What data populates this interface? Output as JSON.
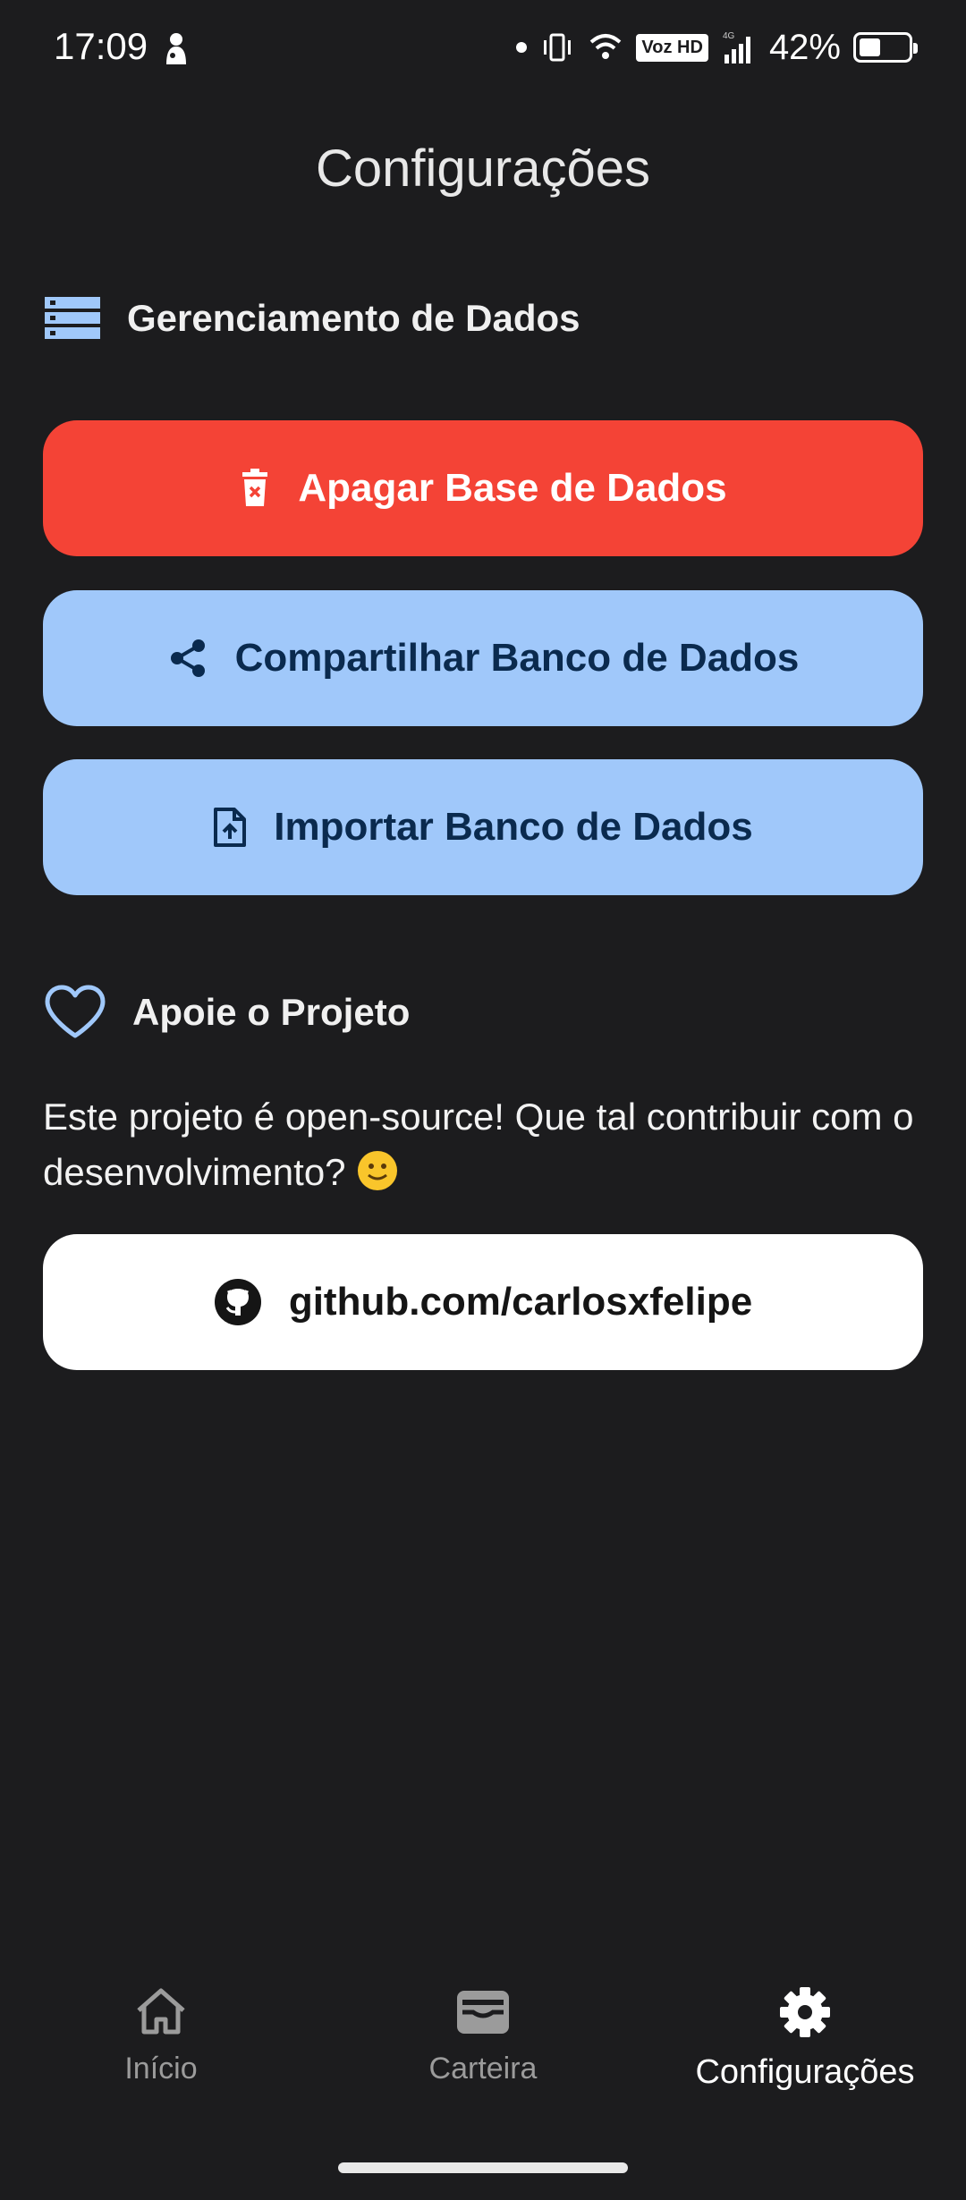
{
  "status_bar": {
    "time": "17:09",
    "voz_label": "Voz HD",
    "network_label": "4G",
    "battery_text": "42%",
    "battery_level": 0.42
  },
  "page": {
    "title": "Configurações"
  },
  "data_section": {
    "title": "Gerenciamento de Dados",
    "icon": "storage-icon",
    "buttons": {
      "delete": {
        "label": "Apagar Base de Dados",
        "icon": "delete-icon",
        "color": "#f44336"
      },
      "share": {
        "label": "Compartilhar Banco de Dados",
        "icon": "share-icon",
        "color": "#a0c8fa"
      },
      "import": {
        "label": "Importar Banco de Dados",
        "icon": "upload-file-icon",
        "color": "#a0c8fa"
      }
    }
  },
  "support_section": {
    "title": "Apoie o Projeto",
    "icon": "heart-icon",
    "text": "Este projeto é open-source! Que tal contribuir com o desenvolvimento?",
    "emoji": "🙂",
    "github_button": {
      "label": "github.com/carlosxfelipe",
      "icon": "github-icon"
    }
  },
  "bottom_nav": {
    "items": [
      {
        "label": "Início",
        "icon": "home-icon",
        "active": false
      },
      {
        "label": "Carteira",
        "icon": "wallet-icon",
        "active": false
      },
      {
        "label": "Configurações",
        "icon": "settings-icon",
        "active": true
      }
    ]
  }
}
